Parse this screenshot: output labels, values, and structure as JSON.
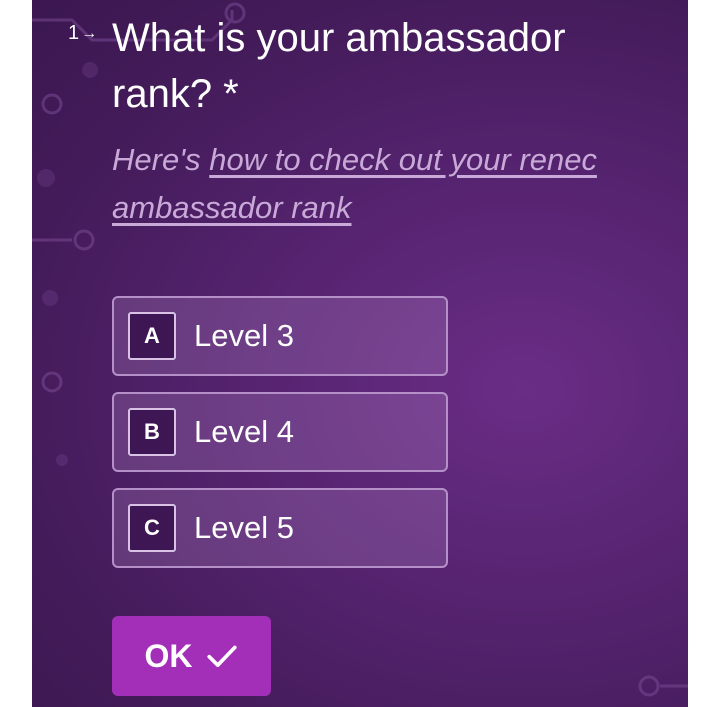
{
  "question": {
    "number": "1",
    "arrow_icon": "right-arrow-icon",
    "title": "What is your ambassador rank? *",
    "description_prefix": "Here's ",
    "description_link": "how to check out your renec ambassador rank"
  },
  "choices": [
    {
      "key": "A",
      "label": "Level 3"
    },
    {
      "key": "B",
      "label": "Level 4"
    },
    {
      "key": "C",
      "label": "Level 5"
    }
  ],
  "submit": {
    "label": "OK",
    "icon": "checkmark-icon"
  },
  "colors": {
    "background": "#4a1c62",
    "button": "#a32fb8",
    "choice_border": "#b58fc8",
    "description_text": "#c8a9d8"
  }
}
